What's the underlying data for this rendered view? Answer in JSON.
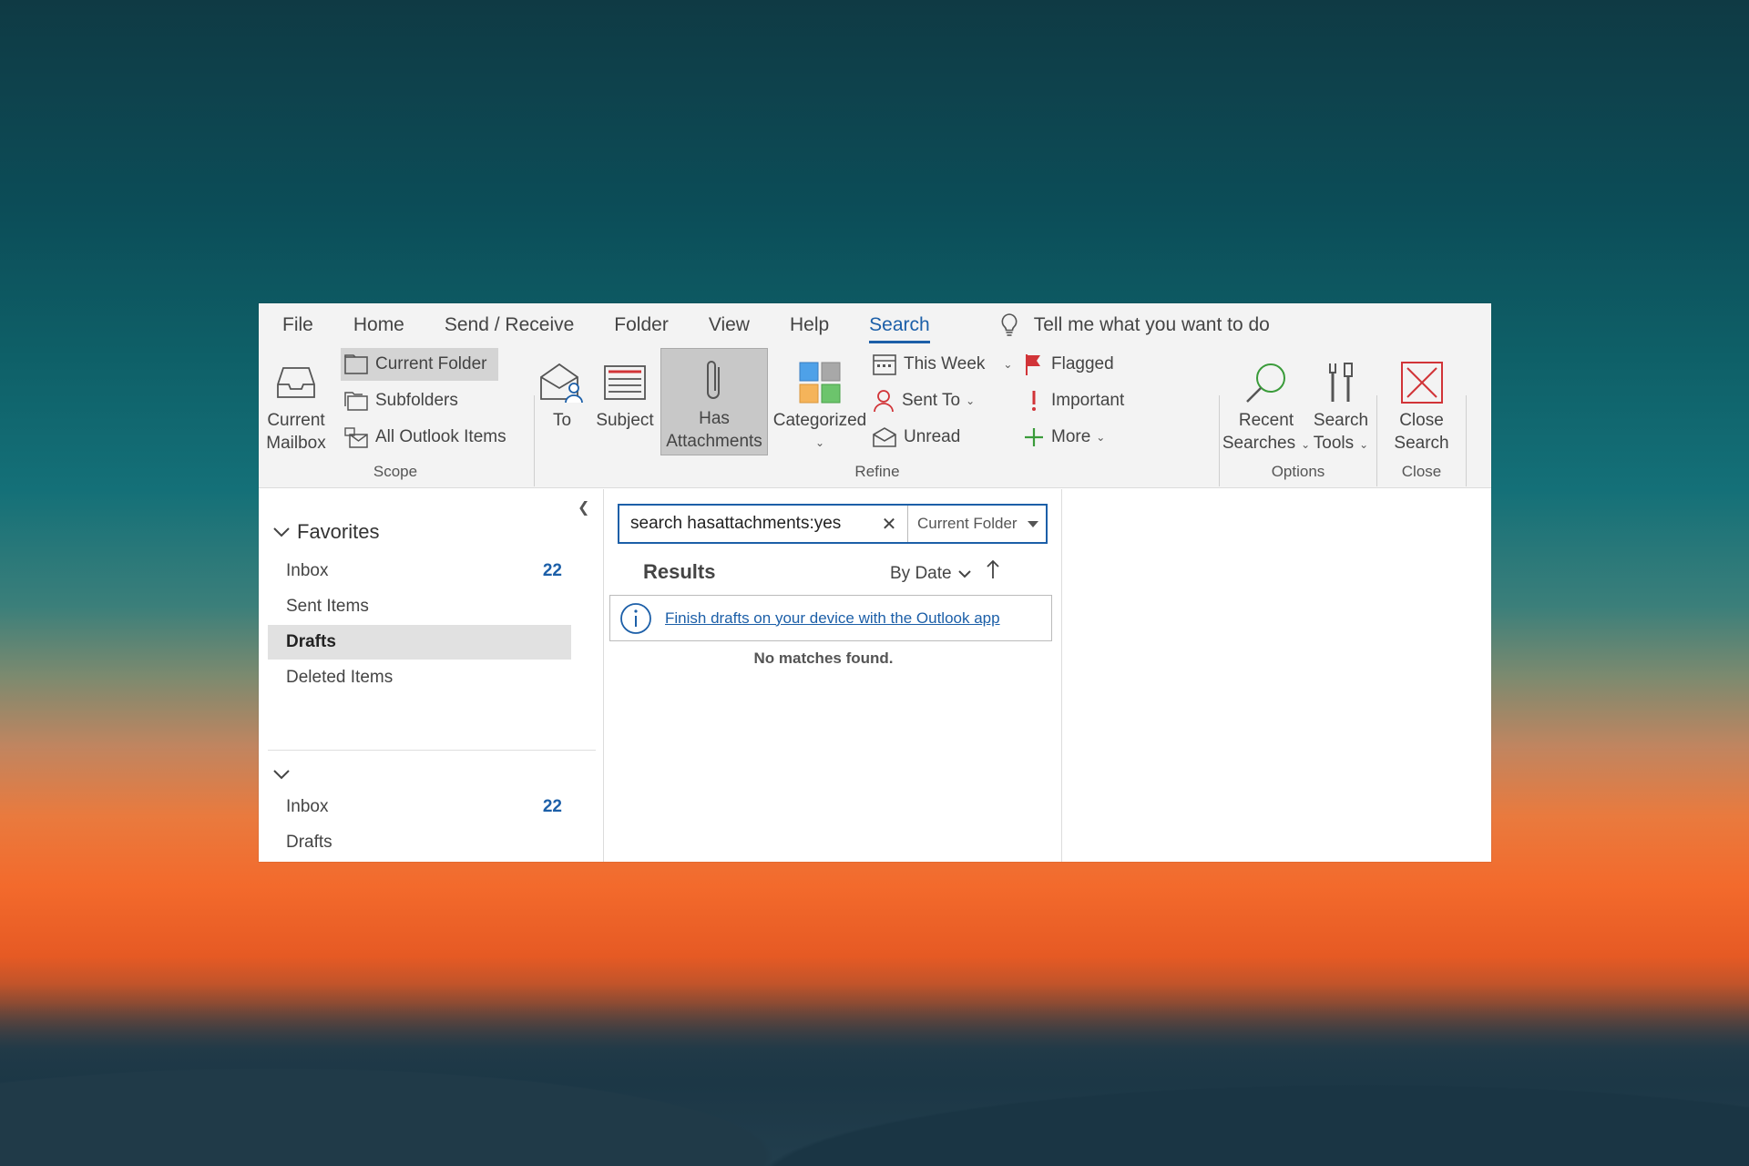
{
  "menu": {
    "tabs": [
      "File",
      "Home",
      "Send / Receive",
      "Folder",
      "View",
      "Help",
      "Search"
    ],
    "active_tab": "Search",
    "tell_me": "Tell me what you want to do"
  },
  "ribbon": {
    "scope": {
      "label": "Scope",
      "current_mailbox_line1": "Current",
      "current_mailbox_line2": "Mailbox",
      "current_folder": "Current Folder",
      "subfolders": "Subfolders",
      "all_outlook_items": "All Outlook Items"
    },
    "refine": {
      "label": "Refine",
      "to": "To",
      "subject": "Subject",
      "has_attachments_line1": "Has",
      "has_attachments_line2": "Attachments",
      "categorized": "Categorized",
      "this_week": "This Week",
      "sent_to": "Sent To",
      "unread": "Unread",
      "flagged": "Flagged",
      "important": "Important",
      "more": "More"
    },
    "options": {
      "label": "Options",
      "recent_line1": "Recent",
      "recent_line2": "Searches",
      "tools_line1": "Search",
      "tools_line2": "Tools"
    },
    "close": {
      "label": "Close",
      "close_line1": "Close",
      "close_line2": "Search"
    }
  },
  "nav": {
    "favorites_label": "Favorites",
    "favorites": [
      {
        "label": "Inbox",
        "count": "22"
      },
      {
        "label": "Sent Items",
        "count": ""
      },
      {
        "label": "Drafts",
        "count": ""
      },
      {
        "label": "Deleted Items",
        "count": ""
      }
    ],
    "account_folders": [
      {
        "label": "Inbox",
        "count": "22"
      },
      {
        "label": "Drafts",
        "count": ""
      }
    ]
  },
  "search": {
    "query": "search hasattachments:yes",
    "scope_value": "Current Folder",
    "results_label": "Results",
    "sort_label": "By Date",
    "info_link": "Finish drafts on your device with the Outlook app",
    "no_matches": "No matches found."
  },
  "colors": {
    "accent": "#1c5fa8",
    "flag_red": "#d13438",
    "more_green": "#3a9b3a"
  }
}
